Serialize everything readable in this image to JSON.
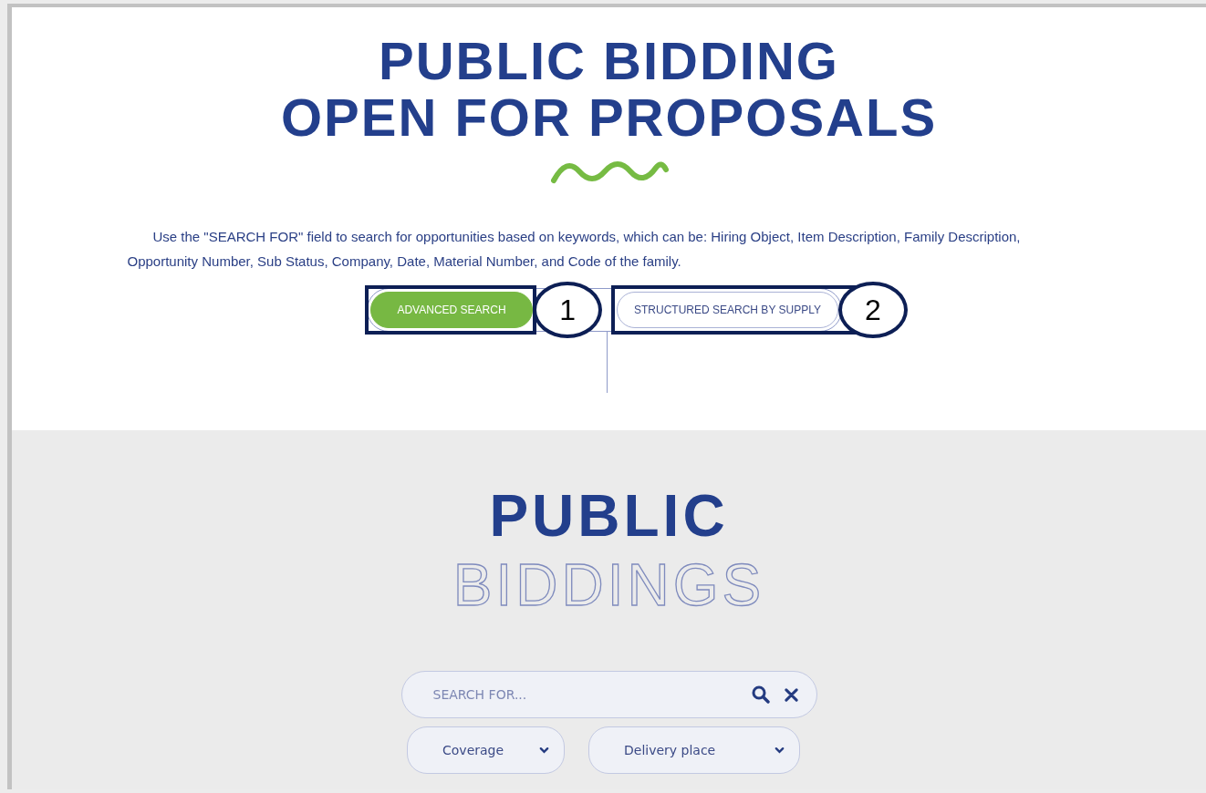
{
  "header": {
    "title_lines": [
      "PUBLIC BIDDING",
      "OPEN FOR PROPOSALS"
    ],
    "intro": "Use the \"SEARCH FOR\" field to search for opportunities based on keywords, which can be: Hiring Object, Item Description, Family Description, Opportunity Number, Sub Status, Company, Date, Material Number, and Code of the family."
  },
  "tabs": [
    {
      "label": "ADVANCED SEARCH",
      "selected": true,
      "callout": "1"
    },
    {
      "label": "STRUCTURED SEARCH BY SUPPLY",
      "selected": false,
      "callout": "2"
    }
  ],
  "section": {
    "title_solid": "PUBLIC",
    "title_outline": "BIDDINGS",
    "search": {
      "placeholder": "SEARCH FOR..."
    },
    "dropdowns": [
      {
        "label": "Coverage"
      },
      {
        "label": "Delivery place"
      }
    ]
  }
}
